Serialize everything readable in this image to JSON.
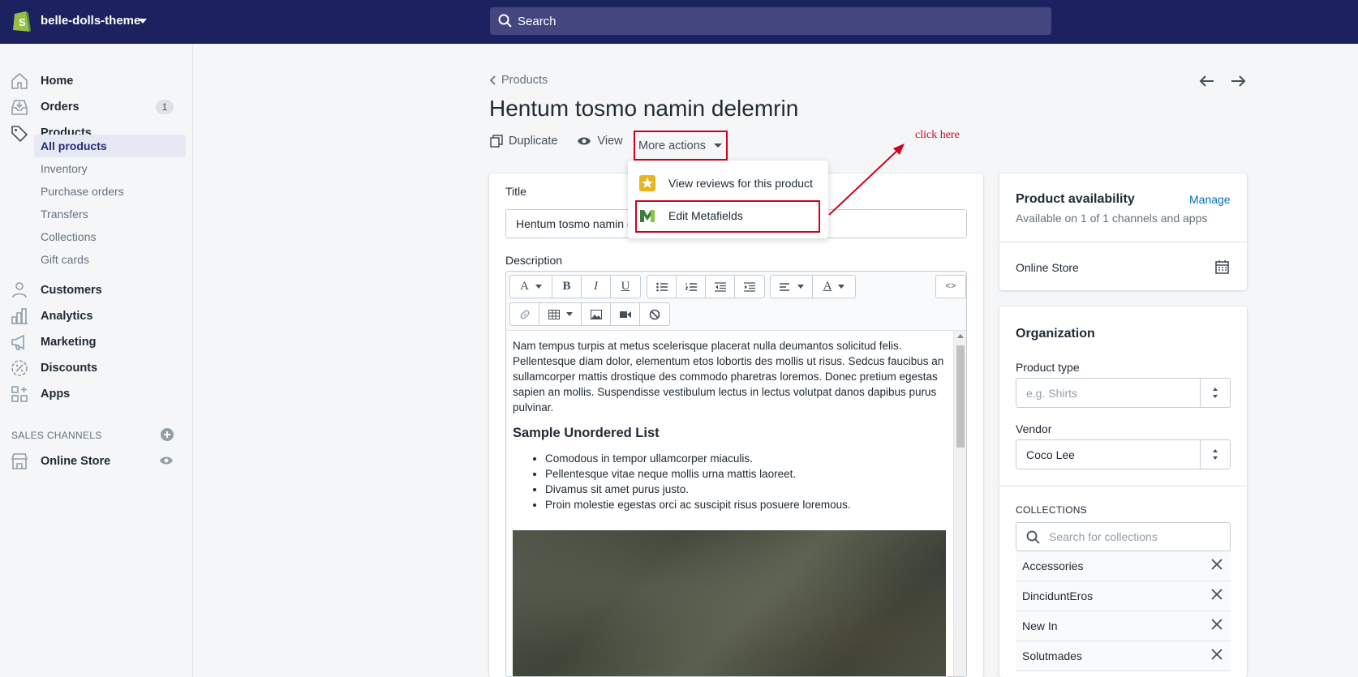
{
  "topbar": {
    "store_name": "belle-dolls-theme",
    "search_placeholder": "Search"
  },
  "sidebar": {
    "items": [
      {
        "label": "Home",
        "icon": "home-icon"
      },
      {
        "label": "Orders",
        "icon": "orders-icon",
        "badge": "1"
      },
      {
        "label": "Products",
        "icon": "tag-icon"
      },
      {
        "label": "Customers",
        "icon": "person-icon"
      },
      {
        "label": "Analytics",
        "icon": "bar-chart-icon"
      },
      {
        "label": "Marketing",
        "icon": "megaphone-icon"
      },
      {
        "label": "Discounts",
        "icon": "discount-icon"
      },
      {
        "label": "Apps",
        "icon": "apps-icon"
      }
    ],
    "product_subitems": [
      "All products",
      "Inventory",
      "Purchase orders",
      "Transfers",
      "Collections",
      "Gift cards"
    ],
    "sales_channels_label": "SALES CHANNELS",
    "online_store": "Online Store"
  },
  "header": {
    "breadcrumb": "Products",
    "title": "Hentum tosmo namin delemrin",
    "actions": {
      "duplicate": "Duplicate",
      "view": "View",
      "more": "More actions"
    }
  },
  "dropdown": {
    "items": [
      {
        "label": "View reviews for this product",
        "icon": "star-icon"
      },
      {
        "label": "Edit Metafields",
        "icon": "metafields-logo-icon"
      }
    ]
  },
  "annotation": {
    "text": "click here",
    "color": "#d0021b"
  },
  "form": {
    "title_label": "Title",
    "title_value": "Hentum tosmo namin delemrin",
    "description_label": "Description",
    "description": {
      "paragraph": "Nam tempus turpis at metus scelerisque placerat nulla deumantos solicitud felis. Pellentesque diam dolor, elementum etos lobortis des mollis ut risus. Sedcus faucibus an sullamcorper mattis drostique des commodo pharetras loremos. Donec pretium egestas sapien an mollis. Suspendisse vestibulum lectus in lectus volutpat danos dapibus purus pulvinar.",
      "heading": "Sample Unordered List",
      "list": [
        "Comodous in tempor ullamcorper miaculis.",
        "Pellentesque vitae neque mollis urna mattis laoreet.",
        "Divamus sit amet purus justo.",
        "Proin molestie egestas orci ac suscipit risus posuere loremous."
      ]
    },
    "toolbar": {
      "font": "A",
      "bold": "B",
      "italic": "I",
      "underline": "U",
      "code": "<>"
    }
  },
  "availability": {
    "title": "Product availability",
    "manage": "Manage",
    "subtitle": "Available on 1 of 1 channels and apps",
    "channel": "Online Store"
  },
  "organization": {
    "title": "Organization",
    "product_type_label": "Product type",
    "product_type_placeholder": "e.g. Shirts",
    "vendor_label": "Vendor",
    "vendor_value": "Coco Lee",
    "collections_label": "COLLECTIONS",
    "collections_search_placeholder": "Search for collections",
    "collections": [
      "Accessories",
      "DinciduntEros",
      "New In",
      "Solutmades"
    ]
  },
  "colors": {
    "topbar": "#1c2260",
    "accent": "#202e78",
    "link": "#006fbb",
    "highlight": "#d0021b"
  }
}
